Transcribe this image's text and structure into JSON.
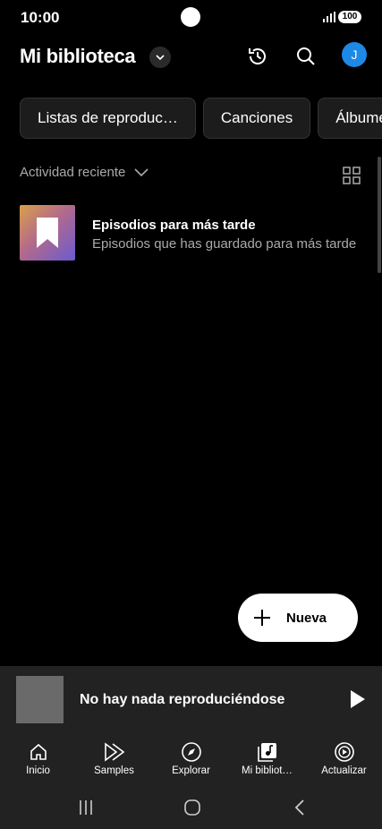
{
  "status": {
    "time": "10:00",
    "battery": "100"
  },
  "header": {
    "title": "Mi biblioteca",
    "avatar_initial": "J"
  },
  "chips": [
    "Listas de reproduc…",
    "Canciones",
    "Álbumes"
  ],
  "activity": {
    "label": "Actividad reciente"
  },
  "list": [
    {
      "title": "Episodios para más tarde",
      "subtitle": "Episodios que has guardado para más tarde"
    }
  ],
  "fab": {
    "label": "Nueva"
  },
  "miniplayer": {
    "text": "No hay nada reproduciéndose"
  },
  "nav": [
    {
      "label": "Inicio",
      "icon": "home-icon"
    },
    {
      "label": "Samples",
      "icon": "samples-icon"
    },
    {
      "label": "Explorar",
      "icon": "compass-icon"
    },
    {
      "label": "Mi bibliot…",
      "icon": "library-icon"
    },
    {
      "label": "Actualizar",
      "icon": "upgrade-icon"
    }
  ],
  "colors": {
    "background": "#000000",
    "surface": "#222222",
    "avatar": "#1e88e5"
  }
}
